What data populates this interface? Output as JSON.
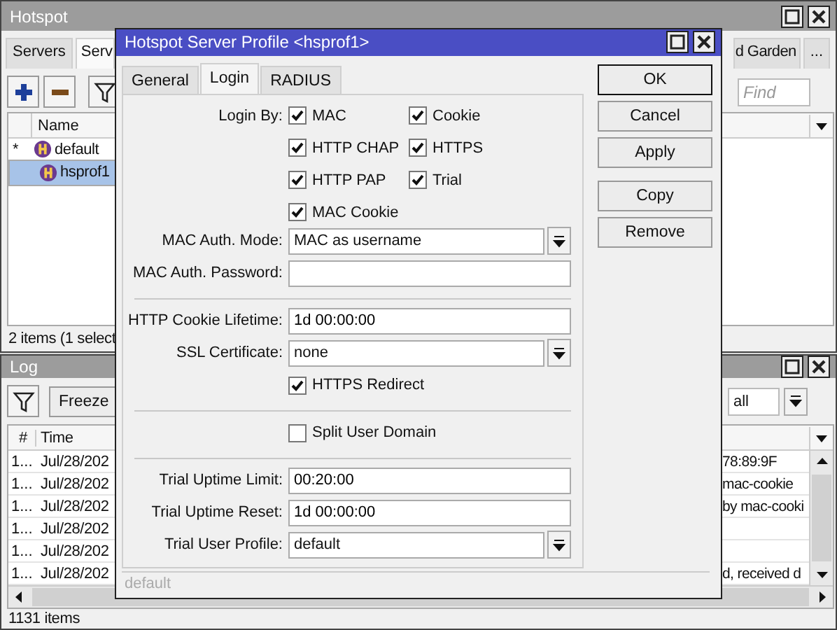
{
  "hotspot_window": {
    "title": "Hotspot",
    "tabs": [
      {
        "label": "Servers",
        "selected": false
      },
      {
        "label": "Serv",
        "selected": true
      },
      {
        "label": "d Garden",
        "selected": false
      },
      {
        "label": "...",
        "selected": false
      }
    ],
    "find": {
      "placeholder": "Find"
    },
    "table": {
      "columns": [
        "Name"
      ],
      "rows": [
        {
          "marker": "*",
          "name": "default",
          "selected": false
        },
        {
          "name": "hsprof1",
          "selected": true
        }
      ]
    },
    "status": "2 items (1 select"
  },
  "log_window": {
    "title": "Log",
    "buttons": [
      "Freeze"
    ],
    "topics": "all",
    "table": {
      "columns": [
        "#",
        "Time"
      ],
      "rows": [
        {
          "number": "1...",
          "time": "Jul/28/202",
          "message": "78:89:9F"
        },
        {
          "number": "1...",
          "time": "Jul/28/202",
          "message": "mac-cookie"
        },
        {
          "number": "1...",
          "time": "Jul/28/202",
          "message": "by mac-cooki"
        },
        {
          "number": "1...",
          "time": "Jul/28/202"
        },
        {
          "number": "1...",
          "time": "Jul/28/202"
        },
        {
          "number": "1...",
          "time": "Jul/28/202",
          "message": "d, received d"
        }
      ]
    },
    "status": "1131 items"
  },
  "dialog": {
    "title": "Hotspot Server Profile <hsprof1>",
    "tabs": [
      {
        "label": "General",
        "selected": false
      },
      {
        "label": "Login",
        "selected": true
      },
      {
        "label": "RADIUS",
        "selected": false
      }
    ],
    "form": [
      {
        "kind": "checkgroup",
        "label": "Login By:",
        "options": [
          {
            "label": "MAC",
            "checked": true
          },
          {
            "label": "Cookie",
            "checked": true
          },
          {
            "label": "HTTP CHAP",
            "checked": true
          },
          {
            "label": "HTTPS",
            "checked": true
          },
          {
            "label": "HTTP PAP",
            "checked": true
          },
          {
            "label": "Trial",
            "checked": true
          },
          {
            "label": "MAC Cookie",
            "checked": true
          }
        ]
      },
      {
        "kind": "select",
        "label": "MAC Auth. Mode:",
        "value": "MAC as username"
      },
      {
        "kind": "input",
        "label": "MAC Auth. Password:"
      },
      {
        "kind": "separator"
      },
      {
        "kind": "input",
        "label": "HTTP Cookie Lifetime:",
        "value": "1d 00:00:00"
      },
      {
        "kind": "select",
        "label": "SSL Certificate:",
        "value": "none"
      },
      {
        "kind": "checkbox",
        "label": "HTTPS Redirect",
        "checked": true
      },
      {
        "kind": "separator"
      },
      {
        "kind": "checkbox",
        "label": "Split User Domain",
        "checked": false
      },
      {
        "kind": "separator"
      },
      {
        "kind": "input",
        "label": "Trial Uptime Limit:",
        "value": "00:20:00"
      },
      {
        "kind": "input",
        "label": "Trial Uptime Reset:",
        "value": "1d 00:00:00"
      },
      {
        "kind": "select",
        "label": "Trial User Profile:",
        "value": "default"
      }
    ],
    "buttons": [
      [
        {
          "label": "OK",
          "default": true
        },
        {
          "label": "Cancel",
          "default": false
        },
        {
          "label": "Apply",
          "default": false
        }
      ],
      [
        {
          "label": "Copy",
          "default": false
        },
        {
          "label": "Remove",
          "default": false
        }
      ]
    ],
    "status": "default"
  }
}
